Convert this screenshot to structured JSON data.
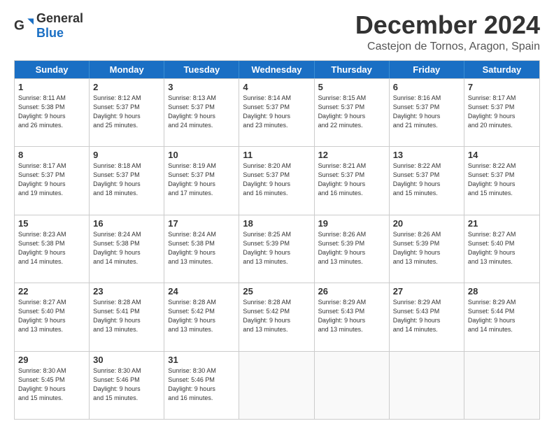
{
  "logo": {
    "general": "General",
    "blue": "Blue"
  },
  "title": "December 2024",
  "location": "Castejon de Tornos, Aragon, Spain",
  "header_days": [
    "Sunday",
    "Monday",
    "Tuesday",
    "Wednesday",
    "Thursday",
    "Friday",
    "Saturday"
  ],
  "rows": [
    [
      {
        "day": "1",
        "info": "Sunrise: 8:11 AM\nSunset: 5:38 PM\nDaylight: 9 hours\nand 26 minutes."
      },
      {
        "day": "2",
        "info": "Sunrise: 8:12 AM\nSunset: 5:37 PM\nDaylight: 9 hours\nand 25 minutes."
      },
      {
        "day": "3",
        "info": "Sunrise: 8:13 AM\nSunset: 5:37 PM\nDaylight: 9 hours\nand 24 minutes."
      },
      {
        "day": "4",
        "info": "Sunrise: 8:14 AM\nSunset: 5:37 PM\nDaylight: 9 hours\nand 23 minutes."
      },
      {
        "day": "5",
        "info": "Sunrise: 8:15 AM\nSunset: 5:37 PM\nDaylight: 9 hours\nand 22 minutes."
      },
      {
        "day": "6",
        "info": "Sunrise: 8:16 AM\nSunset: 5:37 PM\nDaylight: 9 hours\nand 21 minutes."
      },
      {
        "day": "7",
        "info": "Sunrise: 8:17 AM\nSunset: 5:37 PM\nDaylight: 9 hours\nand 20 minutes."
      }
    ],
    [
      {
        "day": "8",
        "info": "Sunrise: 8:17 AM\nSunset: 5:37 PM\nDaylight: 9 hours\nand 19 minutes."
      },
      {
        "day": "9",
        "info": "Sunrise: 8:18 AM\nSunset: 5:37 PM\nDaylight: 9 hours\nand 18 minutes."
      },
      {
        "day": "10",
        "info": "Sunrise: 8:19 AM\nSunset: 5:37 PM\nDaylight: 9 hours\nand 17 minutes."
      },
      {
        "day": "11",
        "info": "Sunrise: 8:20 AM\nSunset: 5:37 PM\nDaylight: 9 hours\nand 16 minutes."
      },
      {
        "day": "12",
        "info": "Sunrise: 8:21 AM\nSunset: 5:37 PM\nDaylight: 9 hours\nand 16 minutes."
      },
      {
        "day": "13",
        "info": "Sunrise: 8:22 AM\nSunset: 5:37 PM\nDaylight: 9 hours\nand 15 minutes."
      },
      {
        "day": "14",
        "info": "Sunrise: 8:22 AM\nSunset: 5:37 PM\nDaylight: 9 hours\nand 15 minutes."
      }
    ],
    [
      {
        "day": "15",
        "info": "Sunrise: 8:23 AM\nSunset: 5:38 PM\nDaylight: 9 hours\nand 14 minutes."
      },
      {
        "day": "16",
        "info": "Sunrise: 8:24 AM\nSunset: 5:38 PM\nDaylight: 9 hours\nand 14 minutes."
      },
      {
        "day": "17",
        "info": "Sunrise: 8:24 AM\nSunset: 5:38 PM\nDaylight: 9 hours\nand 13 minutes."
      },
      {
        "day": "18",
        "info": "Sunrise: 8:25 AM\nSunset: 5:39 PM\nDaylight: 9 hours\nand 13 minutes."
      },
      {
        "day": "19",
        "info": "Sunrise: 8:26 AM\nSunset: 5:39 PM\nDaylight: 9 hours\nand 13 minutes."
      },
      {
        "day": "20",
        "info": "Sunrise: 8:26 AM\nSunset: 5:39 PM\nDaylight: 9 hours\nand 13 minutes."
      },
      {
        "day": "21",
        "info": "Sunrise: 8:27 AM\nSunset: 5:40 PM\nDaylight: 9 hours\nand 13 minutes."
      }
    ],
    [
      {
        "day": "22",
        "info": "Sunrise: 8:27 AM\nSunset: 5:40 PM\nDaylight: 9 hours\nand 13 minutes."
      },
      {
        "day": "23",
        "info": "Sunrise: 8:28 AM\nSunset: 5:41 PM\nDaylight: 9 hours\nand 13 minutes."
      },
      {
        "day": "24",
        "info": "Sunrise: 8:28 AM\nSunset: 5:42 PM\nDaylight: 9 hours\nand 13 minutes."
      },
      {
        "day": "25",
        "info": "Sunrise: 8:28 AM\nSunset: 5:42 PM\nDaylight: 9 hours\nand 13 minutes."
      },
      {
        "day": "26",
        "info": "Sunrise: 8:29 AM\nSunset: 5:43 PM\nDaylight: 9 hours\nand 13 minutes."
      },
      {
        "day": "27",
        "info": "Sunrise: 8:29 AM\nSunset: 5:43 PM\nDaylight: 9 hours\nand 14 minutes."
      },
      {
        "day": "28",
        "info": "Sunrise: 8:29 AM\nSunset: 5:44 PM\nDaylight: 9 hours\nand 14 minutes."
      }
    ],
    [
      {
        "day": "29",
        "info": "Sunrise: 8:30 AM\nSunset: 5:45 PM\nDaylight: 9 hours\nand 15 minutes."
      },
      {
        "day": "30",
        "info": "Sunrise: 8:30 AM\nSunset: 5:46 PM\nDaylight: 9 hours\nand 15 minutes."
      },
      {
        "day": "31",
        "info": "Sunrise: 8:30 AM\nSunset: 5:46 PM\nDaylight: 9 hours\nand 16 minutes."
      },
      {
        "day": "",
        "info": ""
      },
      {
        "day": "",
        "info": ""
      },
      {
        "day": "",
        "info": ""
      },
      {
        "day": "",
        "info": ""
      }
    ]
  ]
}
